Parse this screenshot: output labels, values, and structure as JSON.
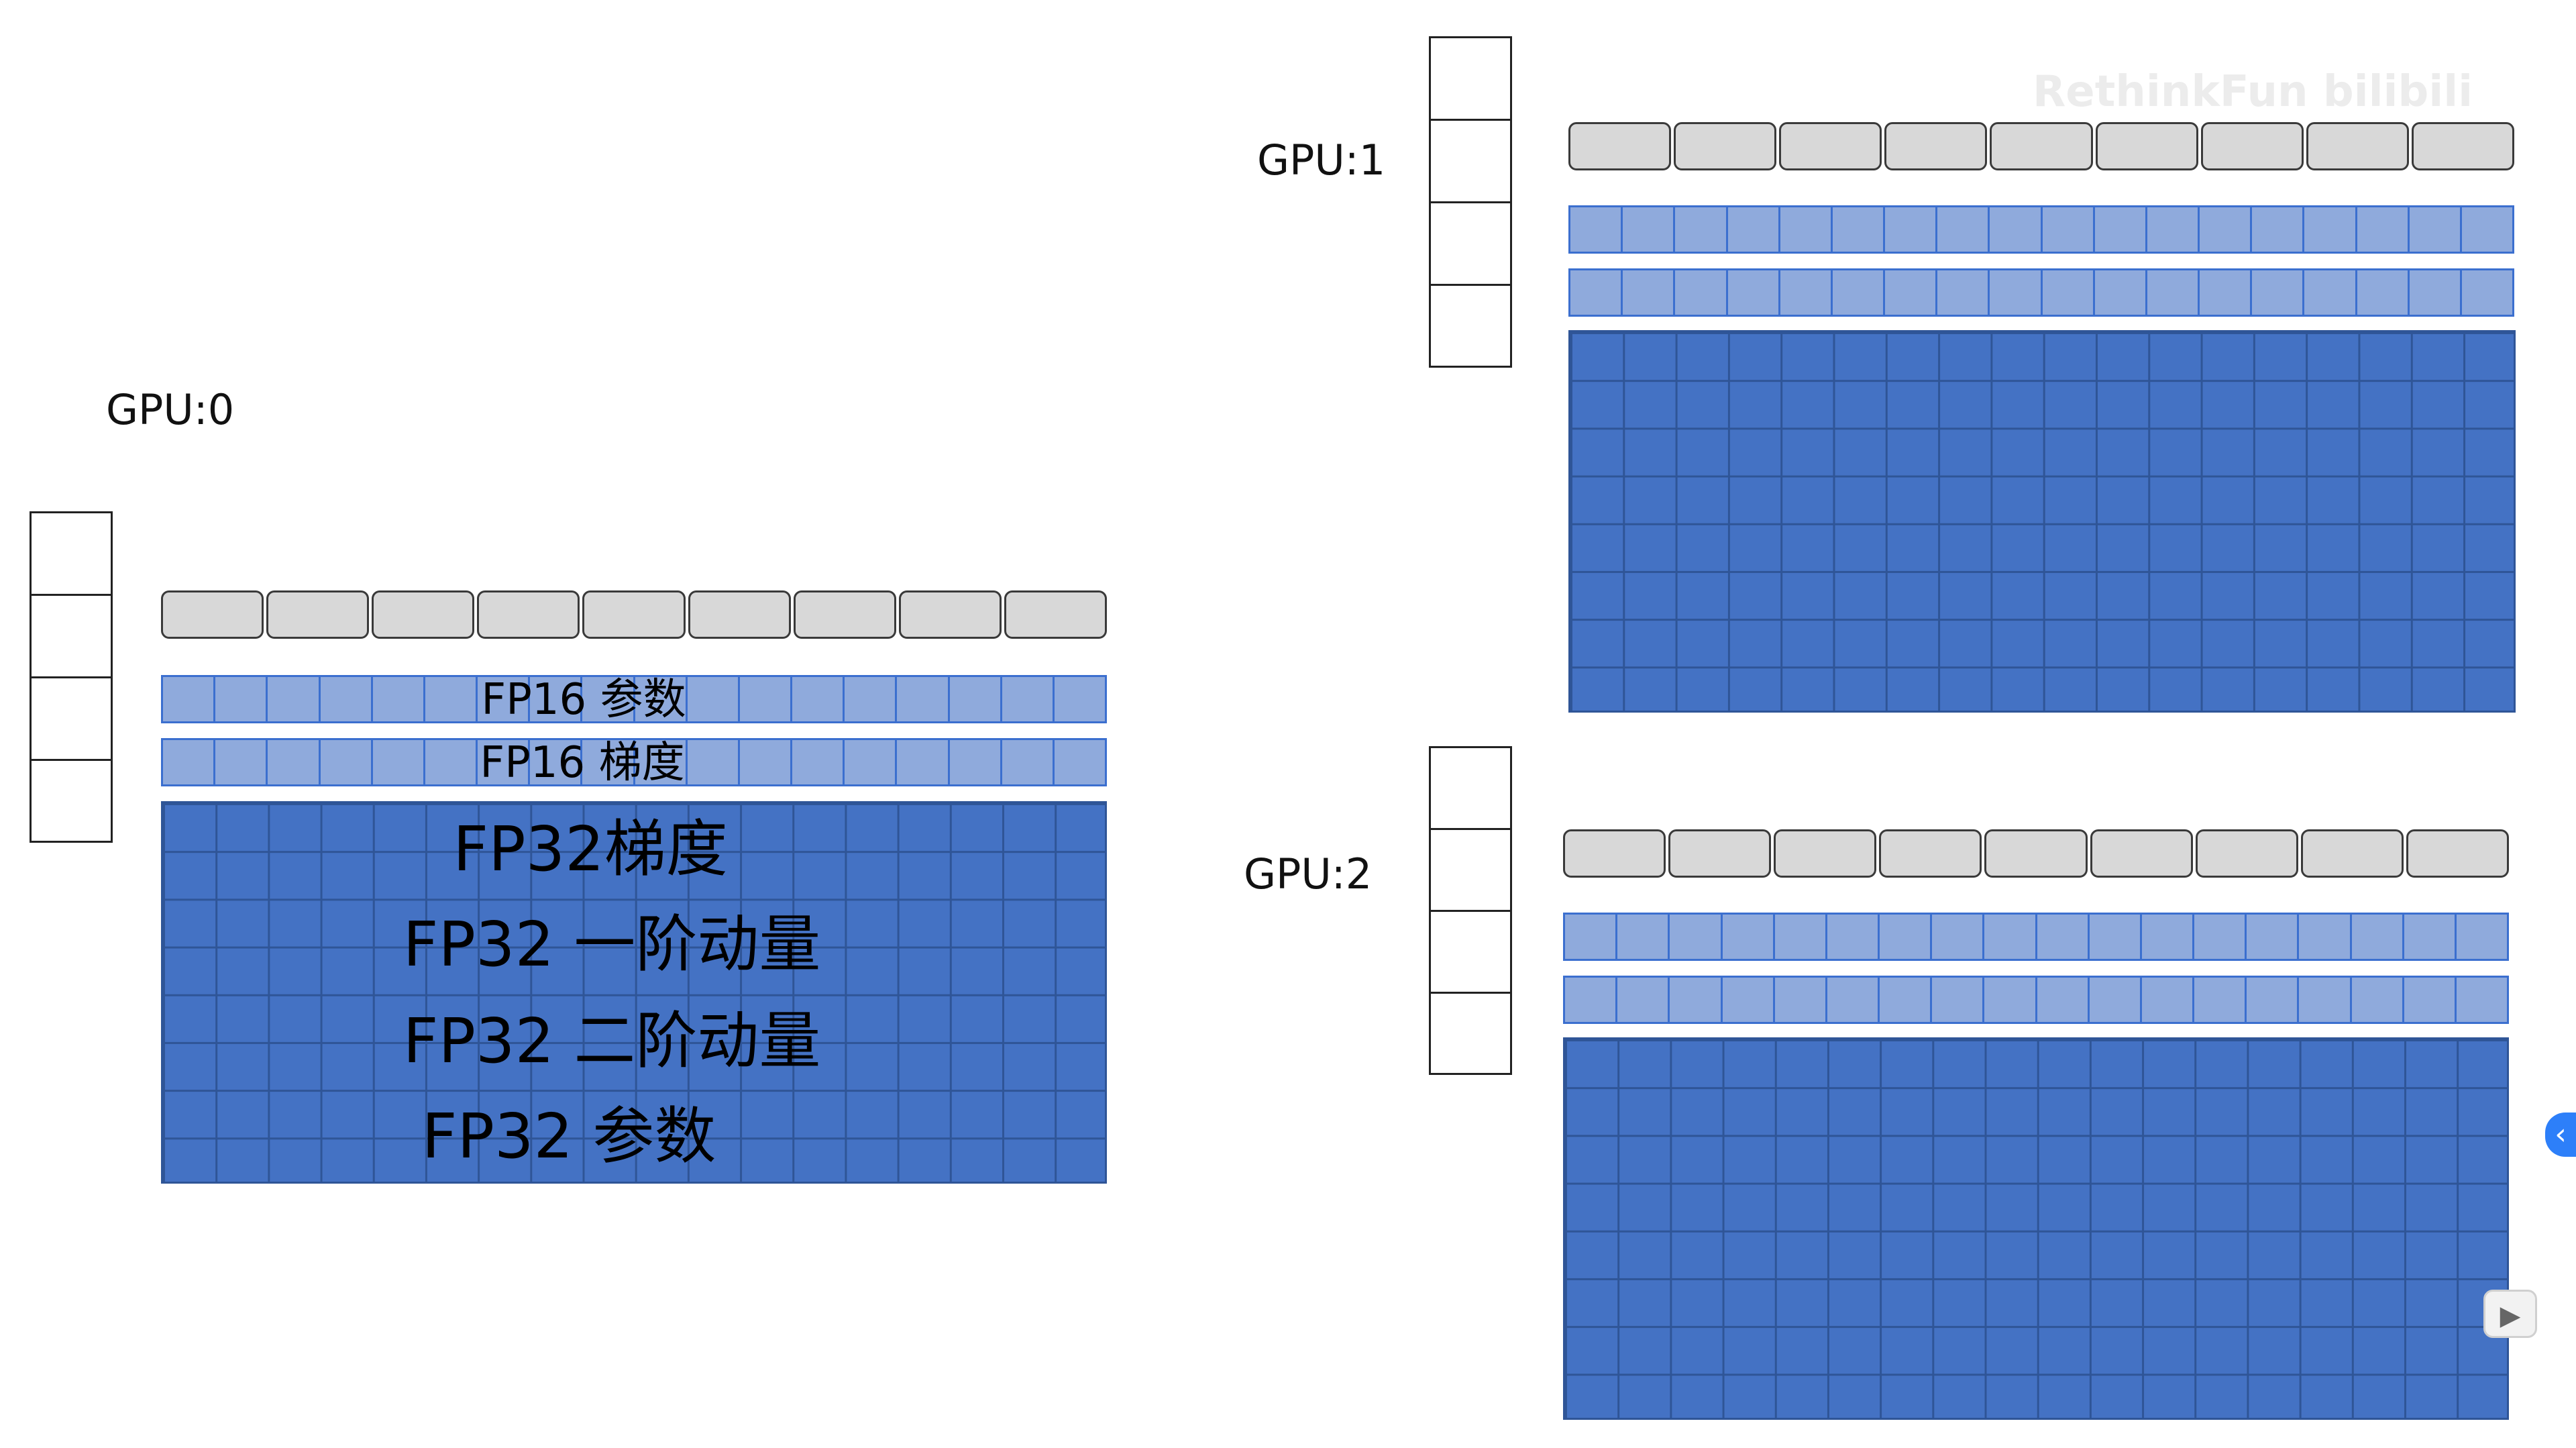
{
  "gpus": {
    "gpu0": {
      "label": "GPU:0"
    },
    "gpu1": {
      "label": "GPU:1"
    },
    "gpu2": {
      "label": "GPU:2"
    }
  },
  "labels": {
    "fp16_params": "FP16 参数",
    "fp16_grads": "FP16 梯度",
    "fp32_grads": "FP32梯度",
    "fp32_moment1": "FP32 一阶动量",
    "fp32_moment2": "FP32 二阶动量",
    "fp32_params": "FP32 参数"
  },
  "watermark": {
    "text": "RethinkFun bilibili"
  },
  "colors": {
    "gray_cell": "#d8d8d8",
    "light_blue": "#8faadc",
    "dark_blue": "#4472c4",
    "grid_line": "#2f5597"
  },
  "icons": {
    "side_button": "chevron-left-icon",
    "side_button2": "video-icon"
  },
  "side_buttons": {
    "side_button": "‹",
    "side_button2": "▶"
  }
}
